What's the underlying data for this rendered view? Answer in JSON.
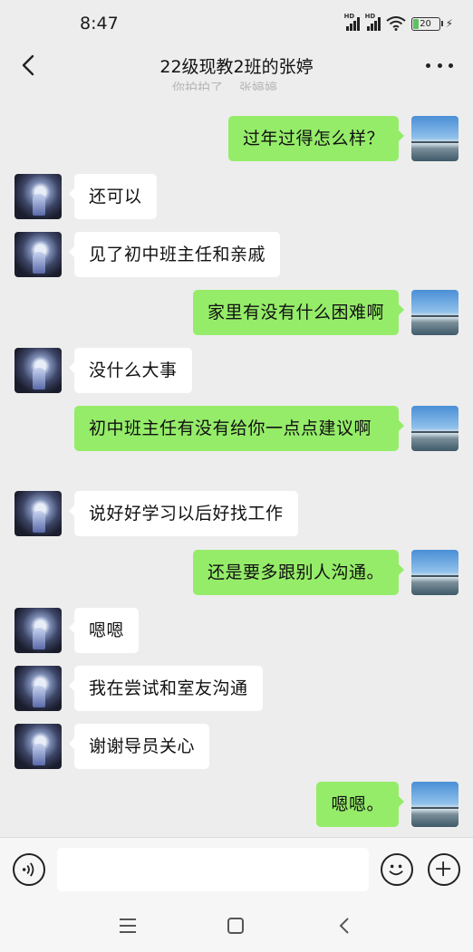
{
  "status_bar": {
    "time": "8:47",
    "hd_label": "HD",
    "battery": "20"
  },
  "header": {
    "title": "22级现教2班的张婷"
  },
  "cut_off_text": [
    "你拍拍了",
    "张婷婷"
  ],
  "messages": [
    {
      "side": "out",
      "text": "过年过得怎么样？"
    },
    {
      "side": "in",
      "text": "还可以"
    },
    {
      "side": "in",
      "text": "见了初中班主任和亲戚"
    },
    {
      "side": "out",
      "text": "家里有没有什么困难啊"
    },
    {
      "side": "in",
      "text": "没什么大事"
    },
    {
      "side": "out",
      "text": "初中班主任有没有给你一点点建议啊"
    },
    {
      "side": "in",
      "text": "说好好学习以后好找工作"
    },
    {
      "side": "out",
      "text": "还是要多跟别人沟通。"
    },
    {
      "side": "in",
      "text": "嗯嗯"
    },
    {
      "side": "in",
      "text": "我在尝试和室友沟通"
    },
    {
      "side": "in",
      "text": "谢谢导员关心"
    },
    {
      "side": "out",
      "text": "嗯嗯。"
    }
  ],
  "input_bar": {
    "value": "",
    "voice_icon": "voice-icon",
    "emoji_icon": "emoji-icon",
    "plus_icon": "plus-icon"
  },
  "colors": {
    "bubble_out": "#95ec69",
    "bubble_in": "#ffffff",
    "background": "#ededed"
  }
}
